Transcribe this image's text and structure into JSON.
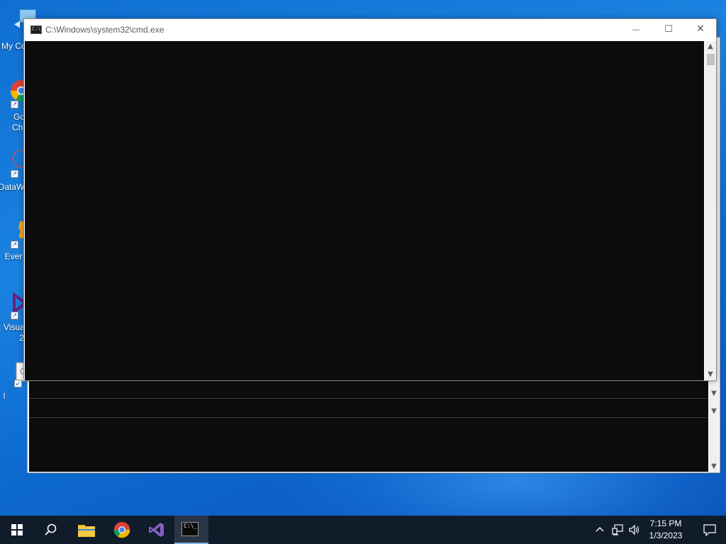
{
  "desktop": {
    "icons": [
      {
        "label": "My Co",
        "icon": "computer-icon"
      },
      {
        "label": "Go\nCh",
        "icon": "chrome-icon"
      },
      {
        "label": "DataW",
        "icon": "datawrapper-icon"
      },
      {
        "label": "Ever",
        "icon": "evernote-icon"
      },
      {
        "label": "Visua\n2",
        "icon": "visual-studio-icon"
      },
      {
        "label": "l",
        "icon": "file-icon"
      }
    ]
  },
  "cmd_window": {
    "title": "C:\\Windows\\system32\\cmd.exe",
    "app_icon_text": "C:\\_",
    "minimize_glyph": "—",
    "maximize_glyph": "☐",
    "close_glyph": "✕",
    "scroll_up_glyph": "▲",
    "scroll_down_glyph": "▼",
    "console_bg": "#0c0c0c"
  },
  "ghost_window": {
    "scroll_down_glyph": "▼"
  },
  "taskbar": {
    "items": [
      {
        "name": "start-button",
        "icon": "windows-logo-icon"
      },
      {
        "name": "search-button",
        "icon": "search-icon"
      },
      {
        "name": "file-explorer-button",
        "icon": "folder-icon"
      },
      {
        "name": "chrome-button",
        "icon": "chrome-icon"
      },
      {
        "name": "visual-studio-button",
        "icon": "visual-studio-icon"
      },
      {
        "name": "cmd-button",
        "icon": "cmd-icon",
        "active": true
      }
    ],
    "tray": {
      "chevron": "^",
      "time": "7:15 PM",
      "date": "1/3/2023"
    }
  },
  "colors": {
    "desktop_blue": "#0f6fd1",
    "taskbar": "#101c2a",
    "console": "#0c0c0c"
  }
}
